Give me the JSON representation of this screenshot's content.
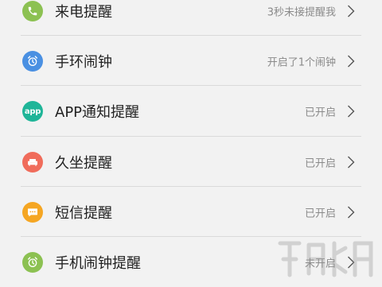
{
  "colors": {
    "phone": "#8cc152",
    "band_alarm": "#4a90e2",
    "app": "#1fb598",
    "sedentary": "#f06c5b",
    "sms": "#f5a623",
    "phone_alarm": "#8cc152"
  },
  "items": [
    {
      "label": "来电提醒",
      "status": "3秒未接提醒我",
      "icon": "phone-icon"
    },
    {
      "label": "手环闹钟",
      "status": "开启了1个闹钟",
      "icon": "alarm-clock-icon"
    },
    {
      "label": "APP通知提醒",
      "status": "已开启",
      "icon": "app-icon",
      "icon_text": "app"
    },
    {
      "label": "久坐提醒",
      "status": "已开启",
      "icon": "sofa-icon"
    },
    {
      "label": "短信提醒",
      "status": "已开启",
      "icon": "message-icon"
    },
    {
      "label": "手机闹钟提醒",
      "status": "未开启",
      "icon": "alarm-clock-icon"
    }
  ]
}
